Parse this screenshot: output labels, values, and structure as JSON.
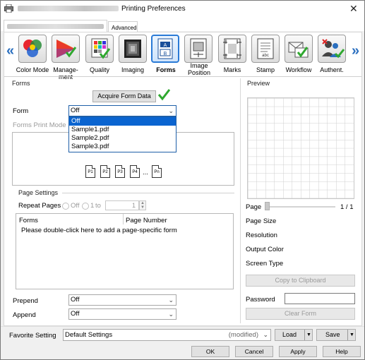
{
  "window": {
    "title": "Printing Preferences",
    "close_glyph": "✕"
  },
  "tabs": {
    "advanced": "Advanced"
  },
  "toolbar": {
    "items": [
      {
        "label": "Color Mode",
        "icon": "color-mode-icon"
      },
      {
        "label": "Manage-\nment",
        "icon": "management-icon"
      },
      {
        "label": "Quality",
        "icon": "quality-icon"
      },
      {
        "label": "Imaging",
        "icon": "imaging-icon"
      },
      {
        "label": "Forms",
        "icon": "forms-icon"
      },
      {
        "label": "Image\nPosition",
        "icon": "image-position-icon"
      },
      {
        "label": "Marks",
        "icon": "marks-icon"
      },
      {
        "label": "Stamp",
        "icon": "stamp-icon"
      },
      {
        "label": "Workflow",
        "icon": "workflow-icon"
      },
      {
        "label": "Authent.",
        "icon": "authentication-icon"
      }
    ],
    "left_arrow": "«",
    "right_arrow": "»"
  },
  "forms": {
    "group_title": "Forms",
    "acquire_button": "Acquire Form Data",
    "form_label": "Form",
    "form_value": "Off",
    "dropdown_options": [
      "Off",
      "Sample1.pdf",
      "Sample2.pdf",
      "Sample3.pdf"
    ],
    "print_mode_label": "Forms Print Mode",
    "pages": [
      "P1",
      "P2",
      "P3",
      "P4",
      "...",
      "Pn"
    ]
  },
  "page_settings": {
    "group_title": "Page Settings",
    "repeat_label": "Repeat Pages",
    "off_label": "Off",
    "range_from": "1",
    "range_to_label": "to",
    "range_to": "1",
    "col_forms": "Forms",
    "col_page_number": "Page Number",
    "hint": "Please double-click here to add a page-specific form"
  },
  "prepend": {
    "label": "Prepend",
    "value": "Off"
  },
  "append": {
    "label": "Append",
    "value": "Off"
  },
  "preview": {
    "title": "Preview",
    "page_label": "Page",
    "page_count": "1 / 1",
    "page_size": "Page Size",
    "resolution": "Resolution",
    "output_color": "Output Color",
    "screen_type": "Screen Type",
    "copy_button": "Copy to Clipboard",
    "password_label": "Password",
    "clear_button": "Clear Form"
  },
  "favorite": {
    "label": "Favorite Setting",
    "value": "Default Settings",
    "modified": "(modified)",
    "load": "Load",
    "save": "Save"
  },
  "footer": {
    "ok": "OK",
    "cancel": "Cancel",
    "apply": "Apply",
    "help": "Help"
  },
  "colors": {
    "accent": "#0a64d0",
    "check": "#2fa82f"
  }
}
